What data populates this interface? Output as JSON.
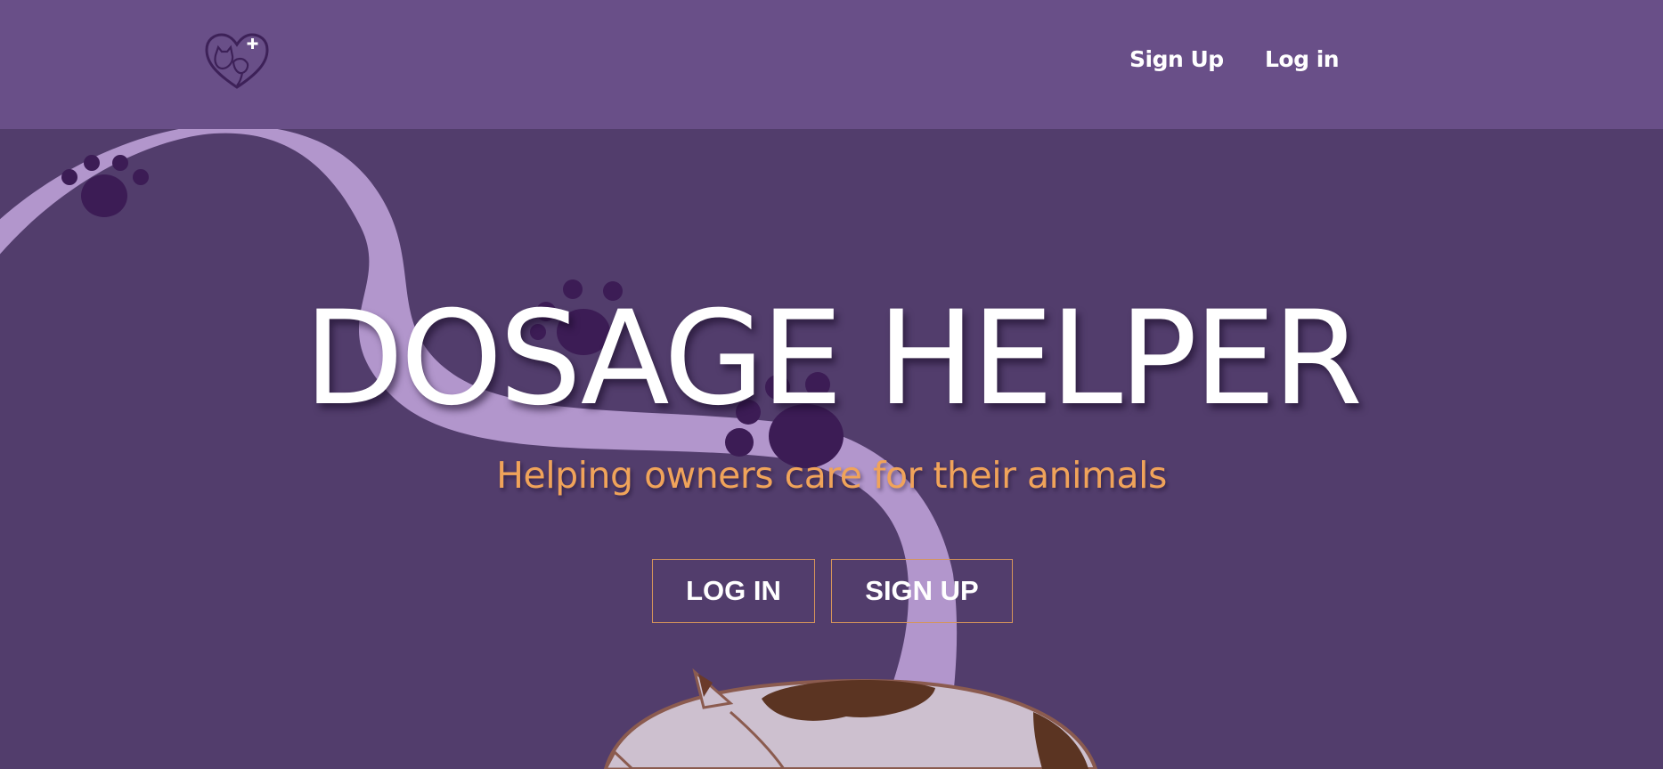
{
  "header": {
    "logo_icon": "heart-pet-cross-icon",
    "nav": {
      "signup_label": "Sign Up",
      "login_label": "Log in"
    }
  },
  "hero": {
    "title": "DOSAGE HELPER",
    "subtitle": "Helping owners care for their animals",
    "buttons": {
      "login_label": "LOG IN",
      "signup_label": "SIGN UP"
    },
    "illustration_icons": [
      "paw-print-icon",
      "cat-tail-illustration",
      "sleeping-cat-illustration"
    ]
  },
  "colors": {
    "navbar_bg": "#694f88",
    "hero_bg": "#523d6c",
    "tail": "#b296cc",
    "paw": "#3c1c55",
    "subtitle": "#f0a35a",
    "button_border": "#d6955a"
  }
}
